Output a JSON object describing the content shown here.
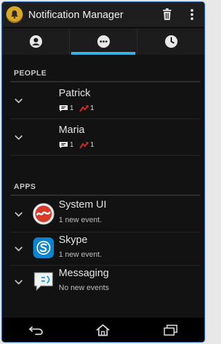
{
  "app": {
    "title": "Notification Manager"
  },
  "icons": {
    "app": "bell-icon",
    "delete": "trash-icon",
    "overflow": "overflow-menu-icon",
    "tab_people": "person-icon",
    "tab_apps": "more-dots-icon",
    "tab_history": "clock-icon"
  },
  "tabs": [
    {
      "name": "people",
      "selected": false
    },
    {
      "name": "apps",
      "selected": true
    },
    {
      "name": "history",
      "selected": false
    }
  ],
  "people": {
    "header": "PEOPLE",
    "items": [
      {
        "name": "Patrick",
        "messages": "1",
        "calls": "1"
      },
      {
        "name": "Maria",
        "messages": "1",
        "calls": "1"
      }
    ]
  },
  "apps": {
    "header": "APPS",
    "items": [
      {
        "name": "System UI",
        "status": "1 new event.",
        "icon": "android-icon"
      },
      {
        "name": "Skype",
        "status": "1 new event.",
        "icon": "skype-icon"
      },
      {
        "name": "Messaging",
        "status": "No new events",
        "icon": "messaging-icon"
      }
    ]
  },
  "colors": {
    "accent": "#33b5e5",
    "missed_call": "#d0261f",
    "app_icon": "#d6a72a"
  }
}
